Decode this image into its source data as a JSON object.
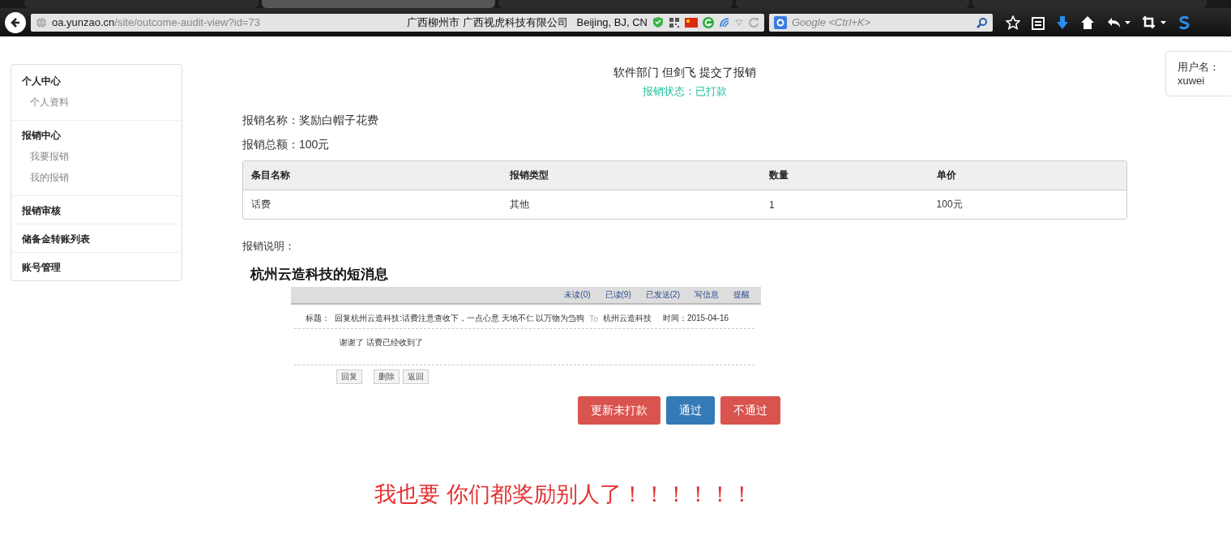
{
  "browser": {
    "tabs": [
      {
        "selected": false
      },
      {
        "selected": true
      },
      {
        "selected": false
      },
      {
        "selected": false
      },
      {
        "selected": false
      }
    ],
    "url_host": "oa.yunzao.cn",
    "url_path": "/site/outcome-audit-view?id=73",
    "location": "广西柳州市 广西视虎科技有限公司   Beijing, BJ, CN",
    "search_placeholder": "Google <Ctrl+K>"
  },
  "sidebar": {
    "groups": [
      {
        "title": "个人中心",
        "items": [
          {
            "label": "个人资料"
          }
        ]
      },
      {
        "title": "报销中心",
        "items": [
          {
            "label": "我要报销"
          },
          {
            "label": "我的报销"
          }
        ]
      },
      {
        "title": "报销审核"
      },
      {
        "title": "储备金转账列表"
      },
      {
        "title": "账号管理"
      }
    ]
  },
  "header": {
    "title": "软件部门 但剑飞 提交了报销",
    "status": "报销状态：已打款"
  },
  "fields": [
    "报销名称：奖励白帽子花费",
    "报销总额：100元"
  ],
  "table": {
    "columns": [
      "条目名称",
      "报销类型",
      "数量",
      "单价"
    ],
    "rows": [
      [
        "话费",
        "其他",
        "1",
        "100元"
      ]
    ]
  },
  "description_label": "报销说明：",
  "message": {
    "title": "杭州云造科技的短消息",
    "tabs": [
      "未读(0)",
      "已读(9)",
      "已发送(2)",
      "写信息",
      "提醒"
    ],
    "subject_label": "标题：",
    "subject": "回复杭州云造科技:话费注意查收下，一点心意 天地不仁 以万物为刍狗",
    "to_label": "To",
    "to": "杭州云造科技",
    "time": "时间：2015-04-16",
    "body": "谢谢了 话费已经收到了",
    "buttons": [
      "回复",
      "删除",
      "返回"
    ]
  },
  "actions": [
    {
      "label": "更新未打款",
      "kind": "danger"
    },
    {
      "label": "通过",
      "kind": "primary"
    },
    {
      "label": "不通过",
      "kind": "danger"
    }
  ],
  "annotation": "我也要 你们都奖励别人了！！！！！！",
  "user_box": {
    "label": "用户名：",
    "name": "xuwei"
  }
}
